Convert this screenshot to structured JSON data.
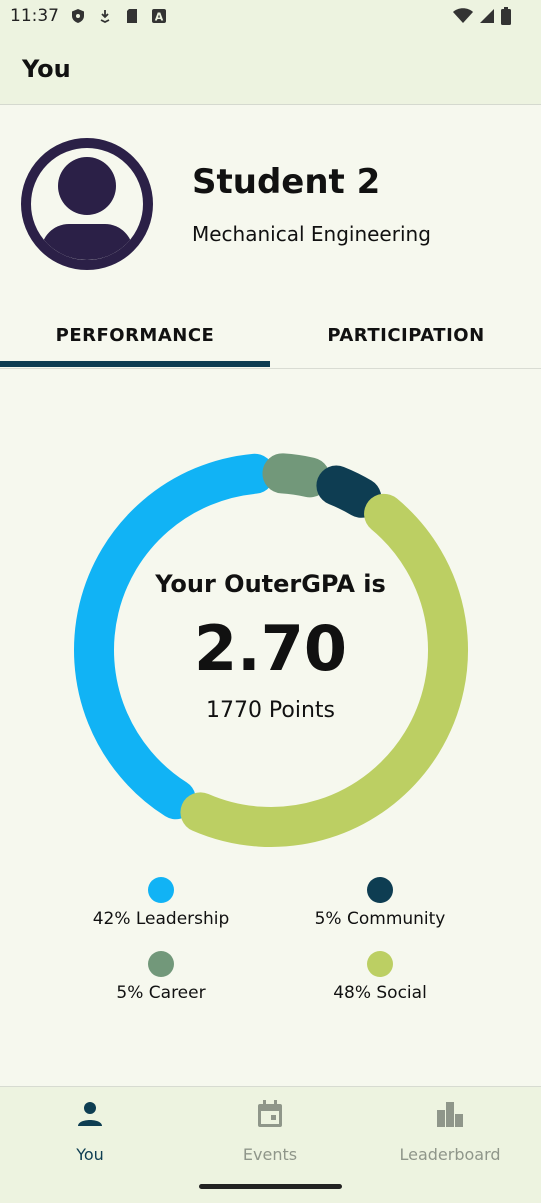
{
  "status_bar": {
    "time": "11:37"
  },
  "app_bar": {
    "title": "You"
  },
  "profile": {
    "name": "Student 2",
    "major": "Mechanical Engineering"
  },
  "tabs": [
    {
      "label": "PERFORMANCE",
      "selected": true
    },
    {
      "label": "PARTICIPATION",
      "selected": false
    }
  ],
  "gpa": {
    "label": "Your OuterGPA is",
    "value": "2.70",
    "points": "1770 Points"
  },
  "chart_data": {
    "type": "pie",
    "categories": [
      "Leadership",
      "Career",
      "Community",
      "Social"
    ],
    "values": [
      42,
      5,
      5,
      48
    ],
    "colors": [
      "#11b3f5",
      "#72987a",
      "#0e3d52",
      "#bccf63"
    ],
    "title": ""
  },
  "legend": [
    {
      "label": "42% Leadership",
      "color": "#11b3f5"
    },
    {
      "label": "5% Community",
      "color": "#0e3d52"
    },
    {
      "label": "5% Career",
      "color": "#72987a"
    },
    {
      "label": "48% Social",
      "color": "#bccf63"
    }
  ],
  "bottom_nav": [
    {
      "label": "You",
      "icon": "person-icon",
      "selected": true
    },
    {
      "label": "Events",
      "icon": "calendar-icon",
      "selected": false
    },
    {
      "label": "Leaderboard",
      "icon": "leaderboard-icon",
      "selected": false
    }
  ],
  "colors": {
    "primary": "#0e3d52",
    "leadership": "#11b3f5",
    "career": "#72987a",
    "community": "#0e3d52",
    "social": "#bccf63",
    "avatar": "#2b2047"
  }
}
